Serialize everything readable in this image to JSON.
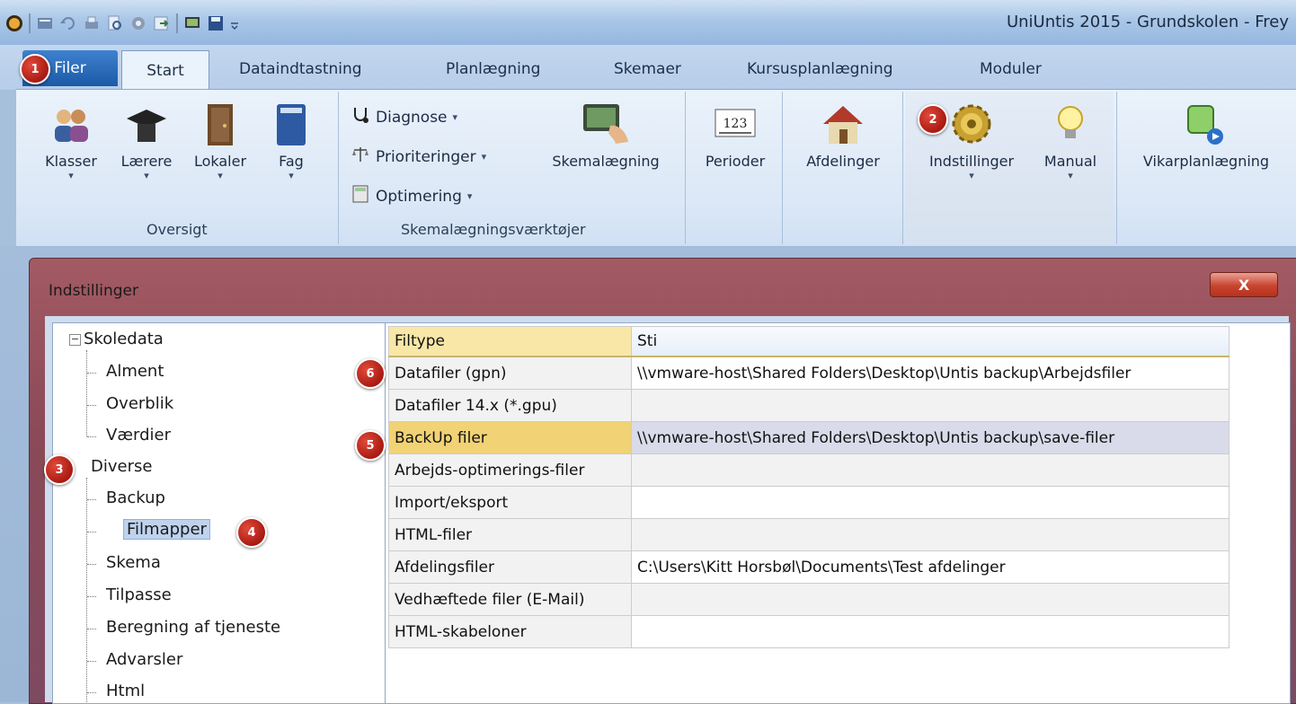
{
  "window": {
    "title": "UniUntis 2015 - Grundskolen  -  Frey"
  },
  "tabs": [
    "Filer",
    "Start",
    "Dataindtastning",
    "Planlægning",
    "Skemaer",
    "Kursusplanlægning",
    "Moduler"
  ],
  "ribbon": {
    "oversigt": {
      "label": "Oversigt",
      "buttons": [
        "Klasser",
        "Lærere",
        "Lokaler",
        "Fag"
      ]
    },
    "skema_tools": {
      "label": "Skemalægningsværktøjer",
      "diagnose": "Diagnose",
      "prioriteringer": "Prioriteringer",
      "optimering": "Optimering",
      "skemalaegning": "Skemalægning"
    },
    "perioder": "Perioder",
    "perioder_icon_text": "123",
    "afdelinger": "Afdelinger",
    "indstillinger": "Indstillinger",
    "manual": "Manual",
    "vikarplanlaegning": "Vikarplanlægning"
  },
  "dialog": {
    "title": "Indstillinger",
    "close": "X"
  },
  "tree": {
    "skoledata": "Skoledata",
    "skoledata_children": [
      "Alment",
      "Overblik",
      "Værdier"
    ],
    "diverse": "Diverse",
    "diverse_children": [
      "Backup",
      "Filmapper",
      "Skema",
      "Tilpasse",
      "Beregning af tjeneste",
      "Advarsler",
      "Html"
    ]
  },
  "grid": {
    "headers": [
      "Filtype",
      "Sti"
    ],
    "rows": [
      [
        "Datafiler (gpn)",
        "\\\\vmware-host\\Shared Folders\\Desktop\\Untis backup\\Arbejdsfiler"
      ],
      [
        "Datafiler 14.x (*.gpu)",
        ""
      ],
      [
        "BackUp filer",
        "\\\\vmware-host\\Shared Folders\\Desktop\\Untis backup\\save-filer"
      ],
      [
        "Arbejds-optimerings-filer",
        ""
      ],
      [
        "Import/eksport",
        ""
      ],
      [
        "HTML-filer",
        ""
      ],
      [
        "Afdelingsfiler",
        "C:\\Users\\Kitt Horsbøl\\Documents\\Test afdelinger"
      ],
      [
        "Vedhæftede filer (E-Mail)",
        ""
      ],
      [
        "HTML-skabeloner",
        ""
      ]
    ]
  },
  "callouts": [
    "1",
    "2",
    "3",
    "4",
    "5",
    "6"
  ],
  "colors": {
    "callout": "#c0281c",
    "dialog_frame": "#8a4a57",
    "header_highlight": "#f9e7a8",
    "selected_row": "#f1d275"
  }
}
